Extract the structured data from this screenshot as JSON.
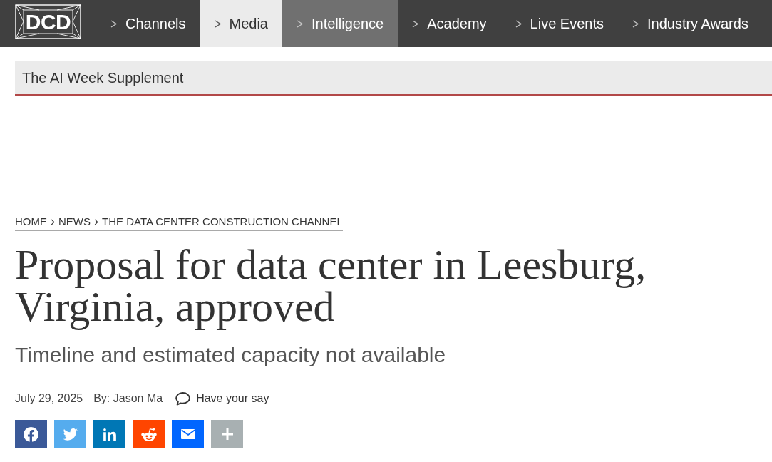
{
  "logo": {
    "text": "DCD"
  },
  "nav": [
    {
      "label": "Channels",
      "selected": false,
      "hovered": false
    },
    {
      "label": "Media",
      "selected": true,
      "hovered": false
    },
    {
      "label": "Intelligence",
      "selected": false,
      "hovered": true
    },
    {
      "label": "Academy",
      "selected": false,
      "hovered": false
    },
    {
      "label": "Live Events",
      "selected": false,
      "hovered": false
    },
    {
      "label": "Industry Awards",
      "selected": false,
      "hovered": false
    }
  ],
  "supplement_bar": {
    "title": "The AI Week Supplement"
  },
  "breadcrumb": [
    "HOME",
    "NEWS",
    "THE DATA CENTER CONSTRUCTION CHANNEL"
  ],
  "article": {
    "title": "Proposal for data center in Leesburg, Virginia, approved",
    "subtitle": "Timeline and estimated capacity not available",
    "date": "July 29, 2025",
    "byline": "By: Jason Ma",
    "comments_link": "Have your say"
  },
  "share_buttons": [
    {
      "kind": "facebook",
      "color": "#3b5998"
    },
    {
      "kind": "twitter",
      "color": "#55acee"
    },
    {
      "kind": "linkedin",
      "color": "#0077b5"
    },
    {
      "kind": "reddit",
      "color": "#ff4500"
    },
    {
      "kind": "email",
      "color": "#0166ff"
    },
    {
      "kind": "more",
      "color": "#a8b0b2"
    }
  ]
}
